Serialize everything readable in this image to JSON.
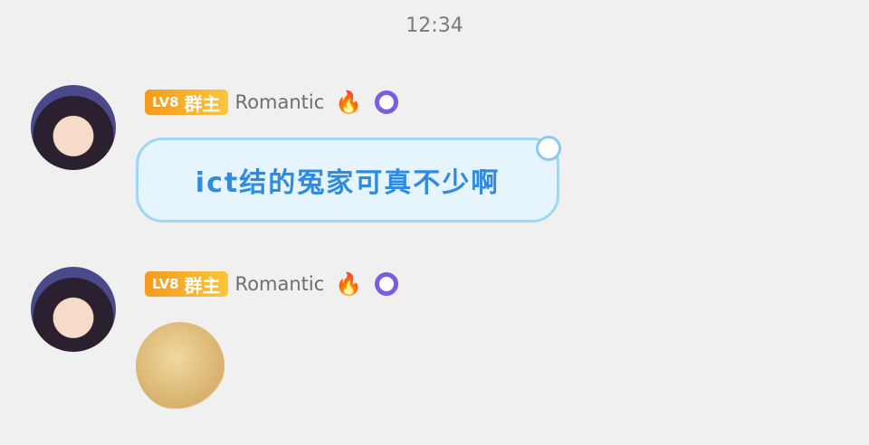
{
  "time": "12:34",
  "messages": [
    {
      "level": "LV8",
      "role": "群主",
      "name": "Romantic",
      "text": "ict结的冤家可真不少啊"
    },
    {
      "level": "LV8",
      "role": "群主",
      "name": "Romantic",
      "sticker": "frowning-face-sticker"
    }
  ]
}
